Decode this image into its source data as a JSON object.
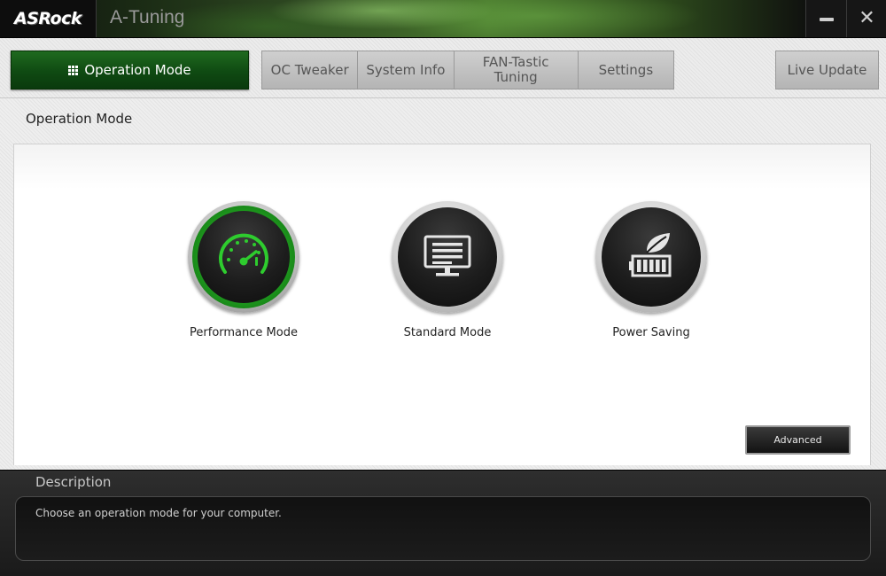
{
  "window": {
    "logo": "ASRock",
    "title": "A-Tuning",
    "minimize_icon": "minimize-icon",
    "close_icon": "close-icon"
  },
  "tabs": {
    "active": {
      "label": "Operation Mode",
      "icon": "grid-icon"
    },
    "items": [
      {
        "label": "OC Tweaker"
      },
      {
        "label": "System Info"
      },
      {
        "label": "FAN-Tastic Tuning"
      },
      {
        "label": "Settings"
      }
    ],
    "live_update": "Live Update"
  },
  "page": {
    "title": "Operation Mode"
  },
  "modes": [
    {
      "label": "Performance Mode",
      "icon": "speedometer-icon",
      "selected": true
    },
    {
      "label": "Standard Mode",
      "icon": "monitor-icon",
      "selected": false
    },
    {
      "label": "Power Saving",
      "icon": "leaf-battery-icon",
      "selected": false
    }
  ],
  "advanced_button": "Advanced",
  "description": {
    "title": "Description",
    "text": "Choose an operation mode for your computer."
  },
  "colors": {
    "accent_green": "#22b022",
    "active_tab": "#0f4a12",
    "panel_bg": "#ffffff",
    "description_bg": "#1a1a1a"
  }
}
